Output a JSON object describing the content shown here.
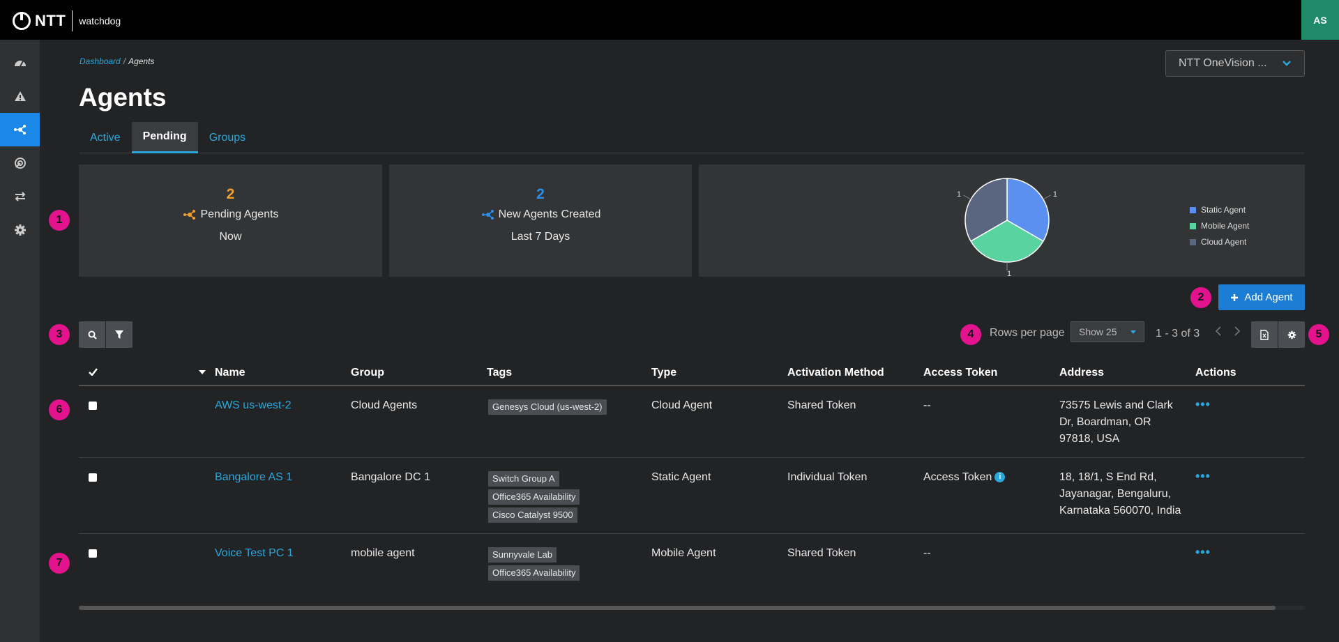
{
  "header": {
    "brand": "NTT",
    "product": "watchdog",
    "user_initials": "AS"
  },
  "sidebar": {
    "items": [
      {
        "icon": "dashboard-gauge-icon",
        "active": false
      },
      {
        "icon": "alert-triangle-icon",
        "active": false
      },
      {
        "icon": "agents-network-icon",
        "active": true
      },
      {
        "icon": "radar-icon",
        "active": false
      },
      {
        "icon": "transfer-arrows-icon",
        "active": false
      },
      {
        "icon": "gear-icon",
        "active": false
      }
    ]
  },
  "breadcrumb": {
    "root": "Dashboard",
    "separator": "/",
    "current": "Agents"
  },
  "page": {
    "title": "Agents"
  },
  "org_select": {
    "value": "NTT OneVision ..."
  },
  "tabs": [
    {
      "label": "Active",
      "active": false
    },
    {
      "label": "Pending",
      "active": true
    },
    {
      "label": "Groups",
      "active": false
    }
  ],
  "cards": {
    "pending": {
      "value": "2",
      "label": "Pending Agents",
      "sub": "Now",
      "color": "#f0a030"
    },
    "created": {
      "value": "2",
      "label": "New Agents Created",
      "sub": "Last 7 Days",
      "color": "#2e8ee8"
    }
  },
  "chart_data": {
    "type": "pie",
    "categories": [
      "Static Agent",
      "Mobile Agent",
      "Cloud Agent"
    ],
    "values": [
      1,
      1,
      1
    ],
    "colors": [
      "#5b8ff0",
      "#59d4a0",
      "#5a6580"
    ],
    "legend_position": "right"
  },
  "markers": [
    "1",
    "2",
    "3",
    "4",
    "5",
    "6",
    "7"
  ],
  "toolbar": {
    "add_agent": "Add Agent",
    "rows_per_page_label": "Rows per page",
    "rows_per_page_value": "Show 25",
    "range": "1 - 3 of 3"
  },
  "table": {
    "columns": [
      "Name",
      "Group",
      "Tags",
      "Type",
      "Activation Method",
      "Access Token",
      "Address",
      "Actions"
    ],
    "rows": [
      {
        "name": "AWS us-west-2",
        "group": "Cloud Agents",
        "tags": [
          "Genesys Cloud (us-west-2)"
        ],
        "type": "Cloud Agent",
        "activation": "Shared Token",
        "token": "--",
        "token_info": false,
        "address": "73575 Lewis and Clark Dr, Boardman, OR 97818, USA"
      },
      {
        "name": "Bangalore AS 1",
        "group": "Bangalore DC 1",
        "tags": [
          "Switch Group A",
          "Office365 Availability",
          "Cisco Catalyst 9500"
        ],
        "type": "Static Agent",
        "activation": "Individual Token",
        "token": "Access Token",
        "token_info": true,
        "address": "18, 18/1, S End Rd, Jayanagar, Bengaluru, Karnataka 560070, India"
      },
      {
        "name": "Voice Test PC 1",
        "group": "mobile agent",
        "tags": [
          "Sunnyvale Lab",
          "Office365 Availability"
        ],
        "type": "Mobile Agent",
        "activation": "Shared Token",
        "token": "--",
        "token_info": false,
        "address": ""
      }
    ]
  }
}
